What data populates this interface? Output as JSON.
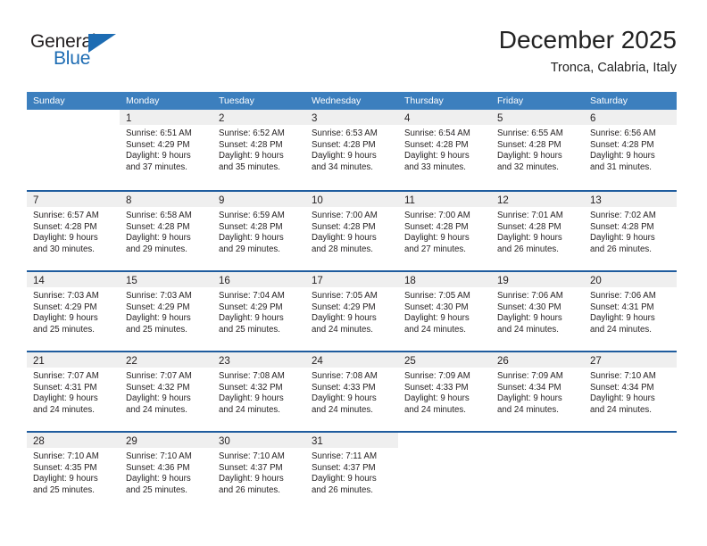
{
  "brand": {
    "name_part1": "General",
    "name_part2": "Blue",
    "color_blue": "#1d6cb3",
    "color_dark": "#231f20"
  },
  "header": {
    "title": "December 2025",
    "subtitle": "Tronca, Calabria, Italy"
  },
  "theme": {
    "header_band": "#3c7fbe",
    "week_divider": "#1f5c9e",
    "daynum_band": "#efefef"
  },
  "weekdays": [
    "Sunday",
    "Monday",
    "Tuesday",
    "Wednesday",
    "Thursday",
    "Friday",
    "Saturday"
  ],
  "weeks": [
    [
      {
        "day": "",
        "lines": []
      },
      {
        "day": "1",
        "lines": [
          "Sunrise: 6:51 AM",
          "Sunset: 4:29 PM",
          "Daylight: 9 hours",
          "and 37 minutes."
        ]
      },
      {
        "day": "2",
        "lines": [
          "Sunrise: 6:52 AM",
          "Sunset: 4:28 PM",
          "Daylight: 9 hours",
          "and 35 minutes."
        ]
      },
      {
        "day": "3",
        "lines": [
          "Sunrise: 6:53 AM",
          "Sunset: 4:28 PM",
          "Daylight: 9 hours",
          "and 34 minutes."
        ]
      },
      {
        "day": "4",
        "lines": [
          "Sunrise: 6:54 AM",
          "Sunset: 4:28 PM",
          "Daylight: 9 hours",
          "and 33 minutes."
        ]
      },
      {
        "day": "5",
        "lines": [
          "Sunrise: 6:55 AM",
          "Sunset: 4:28 PM",
          "Daylight: 9 hours",
          "and 32 minutes."
        ]
      },
      {
        "day": "6",
        "lines": [
          "Sunrise: 6:56 AM",
          "Sunset: 4:28 PM",
          "Daylight: 9 hours",
          "and 31 minutes."
        ]
      }
    ],
    [
      {
        "day": "7",
        "lines": [
          "Sunrise: 6:57 AM",
          "Sunset: 4:28 PM",
          "Daylight: 9 hours",
          "and 30 minutes."
        ]
      },
      {
        "day": "8",
        "lines": [
          "Sunrise: 6:58 AM",
          "Sunset: 4:28 PM",
          "Daylight: 9 hours",
          "and 29 minutes."
        ]
      },
      {
        "day": "9",
        "lines": [
          "Sunrise: 6:59 AM",
          "Sunset: 4:28 PM",
          "Daylight: 9 hours",
          "and 29 minutes."
        ]
      },
      {
        "day": "10",
        "lines": [
          "Sunrise: 7:00 AM",
          "Sunset: 4:28 PM",
          "Daylight: 9 hours",
          "and 28 minutes."
        ]
      },
      {
        "day": "11",
        "lines": [
          "Sunrise: 7:00 AM",
          "Sunset: 4:28 PM",
          "Daylight: 9 hours",
          "and 27 minutes."
        ]
      },
      {
        "day": "12",
        "lines": [
          "Sunrise: 7:01 AM",
          "Sunset: 4:28 PM",
          "Daylight: 9 hours",
          "and 26 minutes."
        ]
      },
      {
        "day": "13",
        "lines": [
          "Sunrise: 7:02 AM",
          "Sunset: 4:28 PM",
          "Daylight: 9 hours",
          "and 26 minutes."
        ]
      }
    ],
    [
      {
        "day": "14",
        "lines": [
          "Sunrise: 7:03 AM",
          "Sunset: 4:29 PM",
          "Daylight: 9 hours",
          "and 25 minutes."
        ]
      },
      {
        "day": "15",
        "lines": [
          "Sunrise: 7:03 AM",
          "Sunset: 4:29 PM",
          "Daylight: 9 hours",
          "and 25 minutes."
        ]
      },
      {
        "day": "16",
        "lines": [
          "Sunrise: 7:04 AM",
          "Sunset: 4:29 PM",
          "Daylight: 9 hours",
          "and 25 minutes."
        ]
      },
      {
        "day": "17",
        "lines": [
          "Sunrise: 7:05 AM",
          "Sunset: 4:29 PM",
          "Daylight: 9 hours",
          "and 24 minutes."
        ]
      },
      {
        "day": "18",
        "lines": [
          "Sunrise: 7:05 AM",
          "Sunset: 4:30 PM",
          "Daylight: 9 hours",
          "and 24 minutes."
        ]
      },
      {
        "day": "19",
        "lines": [
          "Sunrise: 7:06 AM",
          "Sunset: 4:30 PM",
          "Daylight: 9 hours",
          "and 24 minutes."
        ]
      },
      {
        "day": "20",
        "lines": [
          "Sunrise: 7:06 AM",
          "Sunset: 4:31 PM",
          "Daylight: 9 hours",
          "and 24 minutes."
        ]
      }
    ],
    [
      {
        "day": "21",
        "lines": [
          "Sunrise: 7:07 AM",
          "Sunset: 4:31 PM",
          "Daylight: 9 hours",
          "and 24 minutes."
        ]
      },
      {
        "day": "22",
        "lines": [
          "Sunrise: 7:07 AM",
          "Sunset: 4:32 PM",
          "Daylight: 9 hours",
          "and 24 minutes."
        ]
      },
      {
        "day": "23",
        "lines": [
          "Sunrise: 7:08 AM",
          "Sunset: 4:32 PM",
          "Daylight: 9 hours",
          "and 24 minutes."
        ]
      },
      {
        "day": "24",
        "lines": [
          "Sunrise: 7:08 AM",
          "Sunset: 4:33 PM",
          "Daylight: 9 hours",
          "and 24 minutes."
        ]
      },
      {
        "day": "25",
        "lines": [
          "Sunrise: 7:09 AM",
          "Sunset: 4:33 PM",
          "Daylight: 9 hours",
          "and 24 minutes."
        ]
      },
      {
        "day": "26",
        "lines": [
          "Sunrise: 7:09 AM",
          "Sunset: 4:34 PM",
          "Daylight: 9 hours",
          "and 24 minutes."
        ]
      },
      {
        "day": "27",
        "lines": [
          "Sunrise: 7:10 AM",
          "Sunset: 4:34 PM",
          "Daylight: 9 hours",
          "and 24 minutes."
        ]
      }
    ],
    [
      {
        "day": "28",
        "lines": [
          "Sunrise: 7:10 AM",
          "Sunset: 4:35 PM",
          "Daylight: 9 hours",
          "and 25 minutes."
        ]
      },
      {
        "day": "29",
        "lines": [
          "Sunrise: 7:10 AM",
          "Sunset: 4:36 PM",
          "Daylight: 9 hours",
          "and 25 minutes."
        ]
      },
      {
        "day": "30",
        "lines": [
          "Sunrise: 7:10 AM",
          "Sunset: 4:37 PM",
          "Daylight: 9 hours",
          "and 26 minutes."
        ]
      },
      {
        "day": "31",
        "lines": [
          "Sunrise: 7:11 AM",
          "Sunset: 4:37 PM",
          "Daylight: 9 hours",
          "and 26 minutes."
        ]
      },
      {
        "day": "",
        "lines": []
      },
      {
        "day": "",
        "lines": []
      },
      {
        "day": "",
        "lines": []
      }
    ]
  ]
}
